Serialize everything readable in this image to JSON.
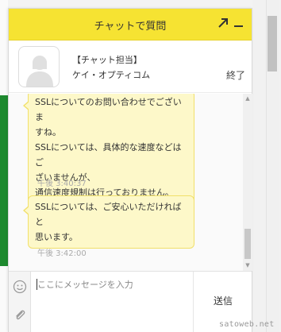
{
  "header": {
    "title": "チャットで質問",
    "expand_icon": "expand-arrow-icon",
    "minimize_icon": "minimize-icon",
    "color": "#f6e332"
  },
  "agent": {
    "role": "【チャット担当】",
    "name": "ケイ・オプティコム",
    "end_label": "終了"
  },
  "messages": [
    {
      "text": "SSLについてのお問い合わせでございま\nすね。\nSSLについては、具体的な速度などはご\nざいませんが、\n通信速度規制は行っておりません。",
      "time": "午後 3:40:37"
    },
    {
      "text": "SSLについては、ご安心いただければと\n思います。",
      "time": "午後 3:42:00"
    }
  ],
  "composer": {
    "placeholder": "ここにメッセージを入力",
    "send_label": "送信",
    "emoji_icon": "emoji-icon",
    "attach_icon": "paperclip-icon"
  },
  "watermark": "satoweb.net",
  "colors": {
    "bubble_bg": "#fdf8c9",
    "bubble_border": "#f1e06a"
  }
}
